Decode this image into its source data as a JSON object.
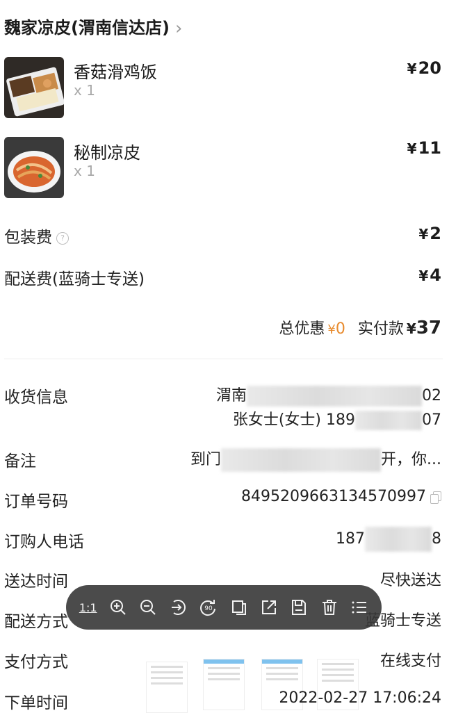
{
  "store": {
    "name": "魏家凉皮(渭南信达店)",
    "chevron_icon": "chevron-right-icon"
  },
  "items": [
    {
      "name": "香菇滑鸡饭",
      "qty": "x 1",
      "currency": "¥",
      "price": "20"
    },
    {
      "name": "秘制凉皮",
      "qty": "x 1",
      "currency": "¥",
      "price": "11"
    }
  ],
  "fees": {
    "packaging_label": "包装费",
    "packaging_currency": "¥",
    "packaging_value": "2",
    "delivery_label": "配送费(蓝骑士专送)",
    "delivery_currency": "¥",
    "delivery_value": "4"
  },
  "summary": {
    "discount_label": "总优惠",
    "discount_currency": "¥",
    "discount_value": "0",
    "paid_label": "实付款",
    "paid_currency": "¥",
    "paid_value": "37"
  },
  "info": {
    "receiver_label": "收货信息",
    "receiver_addr_prefix": "渭南",
    "receiver_addr_suffix": "02",
    "receiver_name_phone": "张女士(女士) 189",
    "receiver_phone_suffix": "07",
    "remark_label": "备注",
    "remark_prefix": "到门",
    "remark_suffix": "开，你...",
    "order_no_label": "订单号码",
    "order_no": "8495209663134570997",
    "buyer_phone_label": "订购人电话",
    "buyer_phone_prefix": "187",
    "buyer_phone_suffix": "8",
    "delivery_time_label": "送达时间",
    "delivery_time": "尽快送达",
    "delivery_method_label": "配送方式",
    "delivery_method": "蓝骑士专送",
    "payment_label": "支付方式",
    "payment": "在线支付",
    "order_time_label": "下单时间",
    "order_time": "2022-02-27 17:06:24"
  },
  "toolbar": {
    "actual_size": "1:1",
    "rotate_label": "90",
    "icons": [
      "zoom-in-icon",
      "zoom-out-icon",
      "share-arrow-icon",
      "rotate-icon",
      "crop-icon",
      "open-external-icon",
      "save-icon",
      "delete-icon",
      "list-icon"
    ]
  },
  "colors": {
    "discount": "#e88b2e",
    "toolbar_bg": "#373737"
  }
}
